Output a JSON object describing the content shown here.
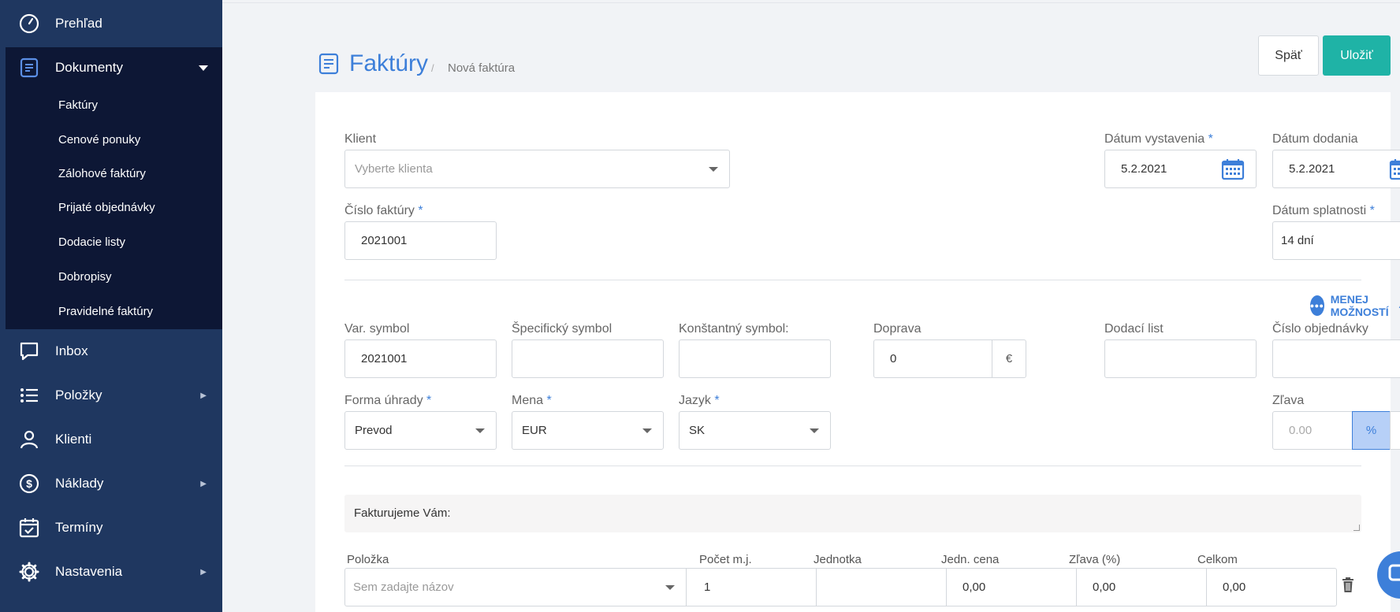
{
  "sidebar": {
    "overview": "Prehľad",
    "documents": "Dokumenty",
    "doc_items": [
      "Faktúry",
      "Cenové ponuky",
      "Zálohové faktúry",
      "Prijaté objednávky",
      "Dodacie listy",
      "Dobropisy",
      "Pravidelné faktúry"
    ],
    "inbox": "Inbox",
    "items": "Položky",
    "clients": "Klienti",
    "costs": "Náklady",
    "deadlines": "Termíny",
    "settings": "Nastavenia"
  },
  "header": {
    "title": "Faktúry",
    "separator": "/",
    "breadcrumb": "Nová faktúra",
    "back_label": "Späť",
    "save_label": "Uložiť"
  },
  "form": {
    "client_label": "Klient",
    "client_placeholder": "Vyberte klienta",
    "issue_date_label": "Dátum vystavenia",
    "issue_date": "5.2.2021",
    "delivery_date_label": "Dátum dodania",
    "delivery_date": "5.2.2021",
    "invoice_no_label": "Číslo faktúry",
    "invoice_no": "2021001",
    "due_label": "Dátum splatnosti",
    "due_value": "14 dní",
    "required_mark": "*",
    "less_options": "MENEJ MOŽNOSTÍ",
    "var_symbol_label": "Var. symbol",
    "var_symbol": "2021001",
    "spec_symbol_label": "Špecifický symbol",
    "const_symbol_label": "Konštantný symbol:",
    "transport_label": "Doprava",
    "transport_value": "0",
    "currency_sign": "€",
    "delivery_note_label": "Dodací list",
    "order_no_label": "Číslo objednávky",
    "payment_label": "Forma úhrady",
    "payment_value": "Prevod",
    "currency_label": "Mena",
    "currency_value": "EUR",
    "language_label": "Jazyk",
    "language_value": "SK",
    "discount_label": "Zľava",
    "discount_placeholder": "0.00",
    "discount_pct": "%",
    "discount_eur": "€",
    "note_text": "Fakturujeme Vám:"
  },
  "table": {
    "headers": [
      "Položka",
      "Počet m.j.",
      "Jednotka",
      "Jedn. cena",
      "Zľava (%)",
      "Celkom"
    ],
    "row": {
      "item_placeholder": "Sem zadajte názov",
      "qty": "1",
      "unit": "",
      "unit_price": "0,00",
      "discount": "0,00",
      "total": "0,00"
    }
  },
  "colors": {
    "sidebar": "#1f3760",
    "sidebar_active": "#0d1735",
    "accent": "#3d7fd9",
    "save": "#1fb3a6"
  }
}
